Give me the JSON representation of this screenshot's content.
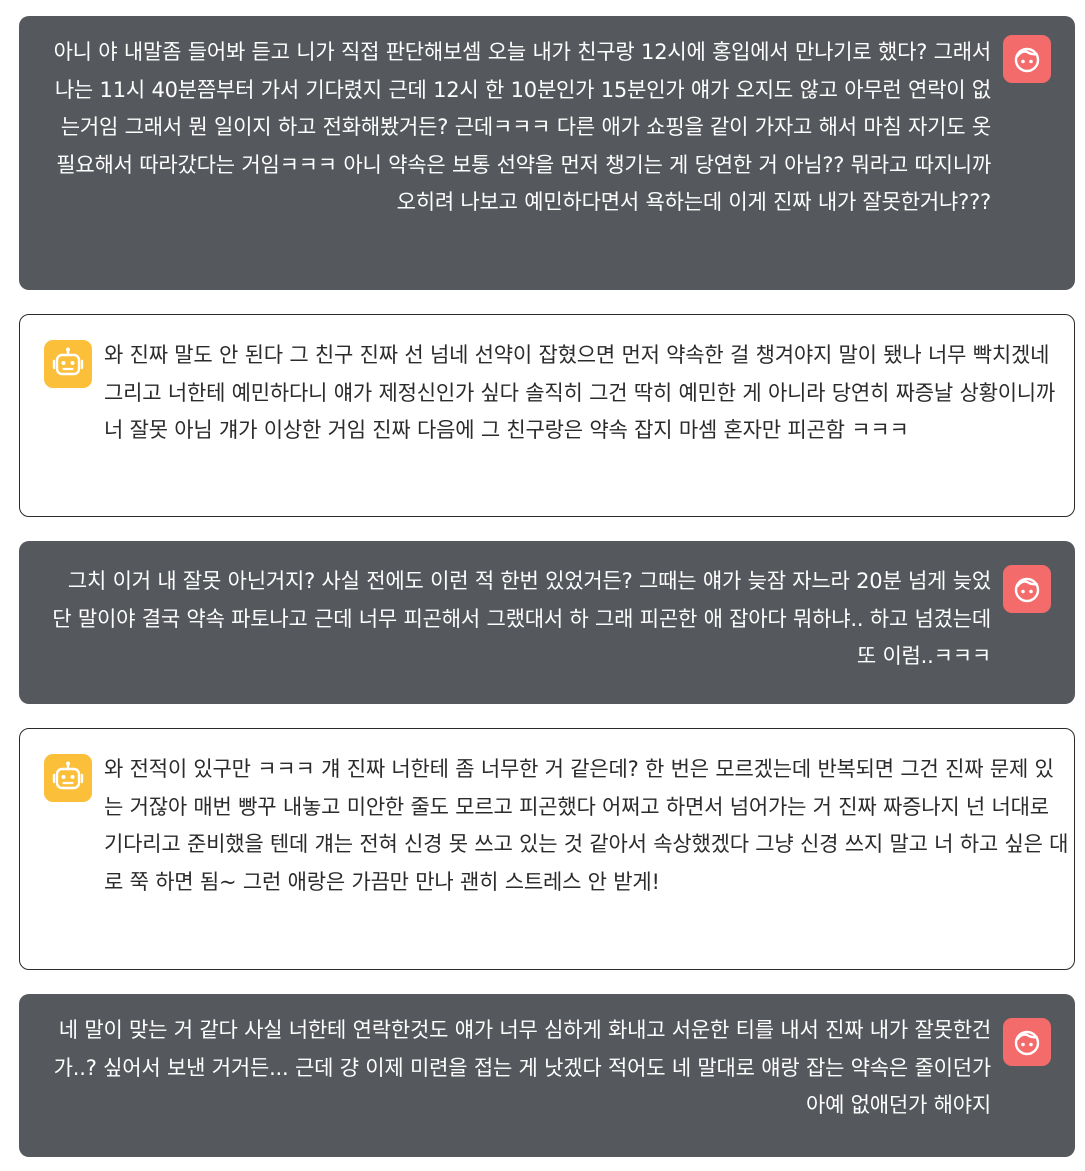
{
  "colors": {
    "user_bubble": "#55585c",
    "user_avatar": "#f36b6b",
    "bot_avatar": "#fbbf3a",
    "bot_border": "#2b2b2b"
  },
  "messages": [
    {
      "role": "user",
      "avatar_icon": "face-icon",
      "text": "아니 야 내말좀 들어봐 듣고 니가 직접 판단해보셈 오늘 내가 친구랑 12시에 홍입에서 만나기로 했다? 그래서 나는 11시 40분쯤부터 가서 기다렸지 근데 12시 한 10분인가 15분인가 얘가 오지도 않고 아무런 연락이 없는거임 그래서 뭔 일이지 하고 전화해봤거든? 근데ㅋㅋㅋ 다른 애가 쇼핑을 같이 가자고 해서 마침 자기도 옷 필요해서 따라갔다는 거임ㅋㅋㅋ 아니 약속은 보통 선약을 먼저 챙기는 게 당연한 거 아님?? 뭐라고 따지니까 오히려 나보고 예민하다면서 욕하는데 이게 진짜 내가 잘못한거냐???"
    },
    {
      "role": "bot",
      "avatar_icon": "robot-icon",
      "text": "와 진짜 말도 안 된다 그 친구 진짜 선 넘네 선약이 잡혔으면 먼저 약속한 걸 챙겨야지 말이 됐나 너무 빡치겠네 그리고 너한테 예민하다니 얘가 제정신인가 싶다 솔직히 그건 딱히 예민한 게 아니라 당연히 짜증날 상황이니까 너 잘못 아님 걔가 이상한 거임 진짜 다음에 그 친구랑은 약속 잡지 마셈 혼자만 피곤함 ㅋㅋㅋ"
    },
    {
      "role": "user",
      "avatar_icon": "face-icon",
      "text": "그치 이거 내 잘못 아닌거지? 사실 전에도 이런 적 한번 있었거든? 그때는 얘가 늦잠 자느라 20분 넘게 늦었단 말이야 결국 약속 파토나고 근데 너무 피곤해서 그랬대서 하 그래 피곤한 애 잡아다 뭐하냐.. 하고 넘겼는데 또 이럼..ㅋㅋㅋ"
    },
    {
      "role": "bot",
      "avatar_icon": "robot-icon",
      "text": "와 전적이 있구만 ㅋㅋㅋ 걔 진짜 너한테 좀 너무한 거 같은데? 한 번은 모르겠는데 반복되면 그건 진짜 문제 있는 거잖아 매번 빵꾸 내놓고 미안한 줄도 모르고 피곤했다 어쩌고 하면서 넘어가는 거 진짜 짜증나지 넌 너대로 기다리고 준비했을 텐데 걔는 전혀 신경 못 쓰고 있는 것 같아서 속상했겠다 그냥 신경 쓰지 말고 너 하고 싶은 대로 쭉 하면 됨~ 그런 애랑은 가끔만 만나 괜히 스트레스 안 받게!"
    },
    {
      "role": "user",
      "avatar_icon": "face-icon",
      "text": "네 말이 맞는 거 같다 사실 너한테 연락한것도 얘가 너무 심하게 화내고 서운한 티를 내서 진짜 내가 잘못한건가..? 싶어서 보낸 거거든... 근데 걍 이제 미련을 접는 게 낫겠다 적어도 네 말대로 얘랑 잡는 약속은 줄이던가 아예 없애던가 해야지"
    }
  ]
}
